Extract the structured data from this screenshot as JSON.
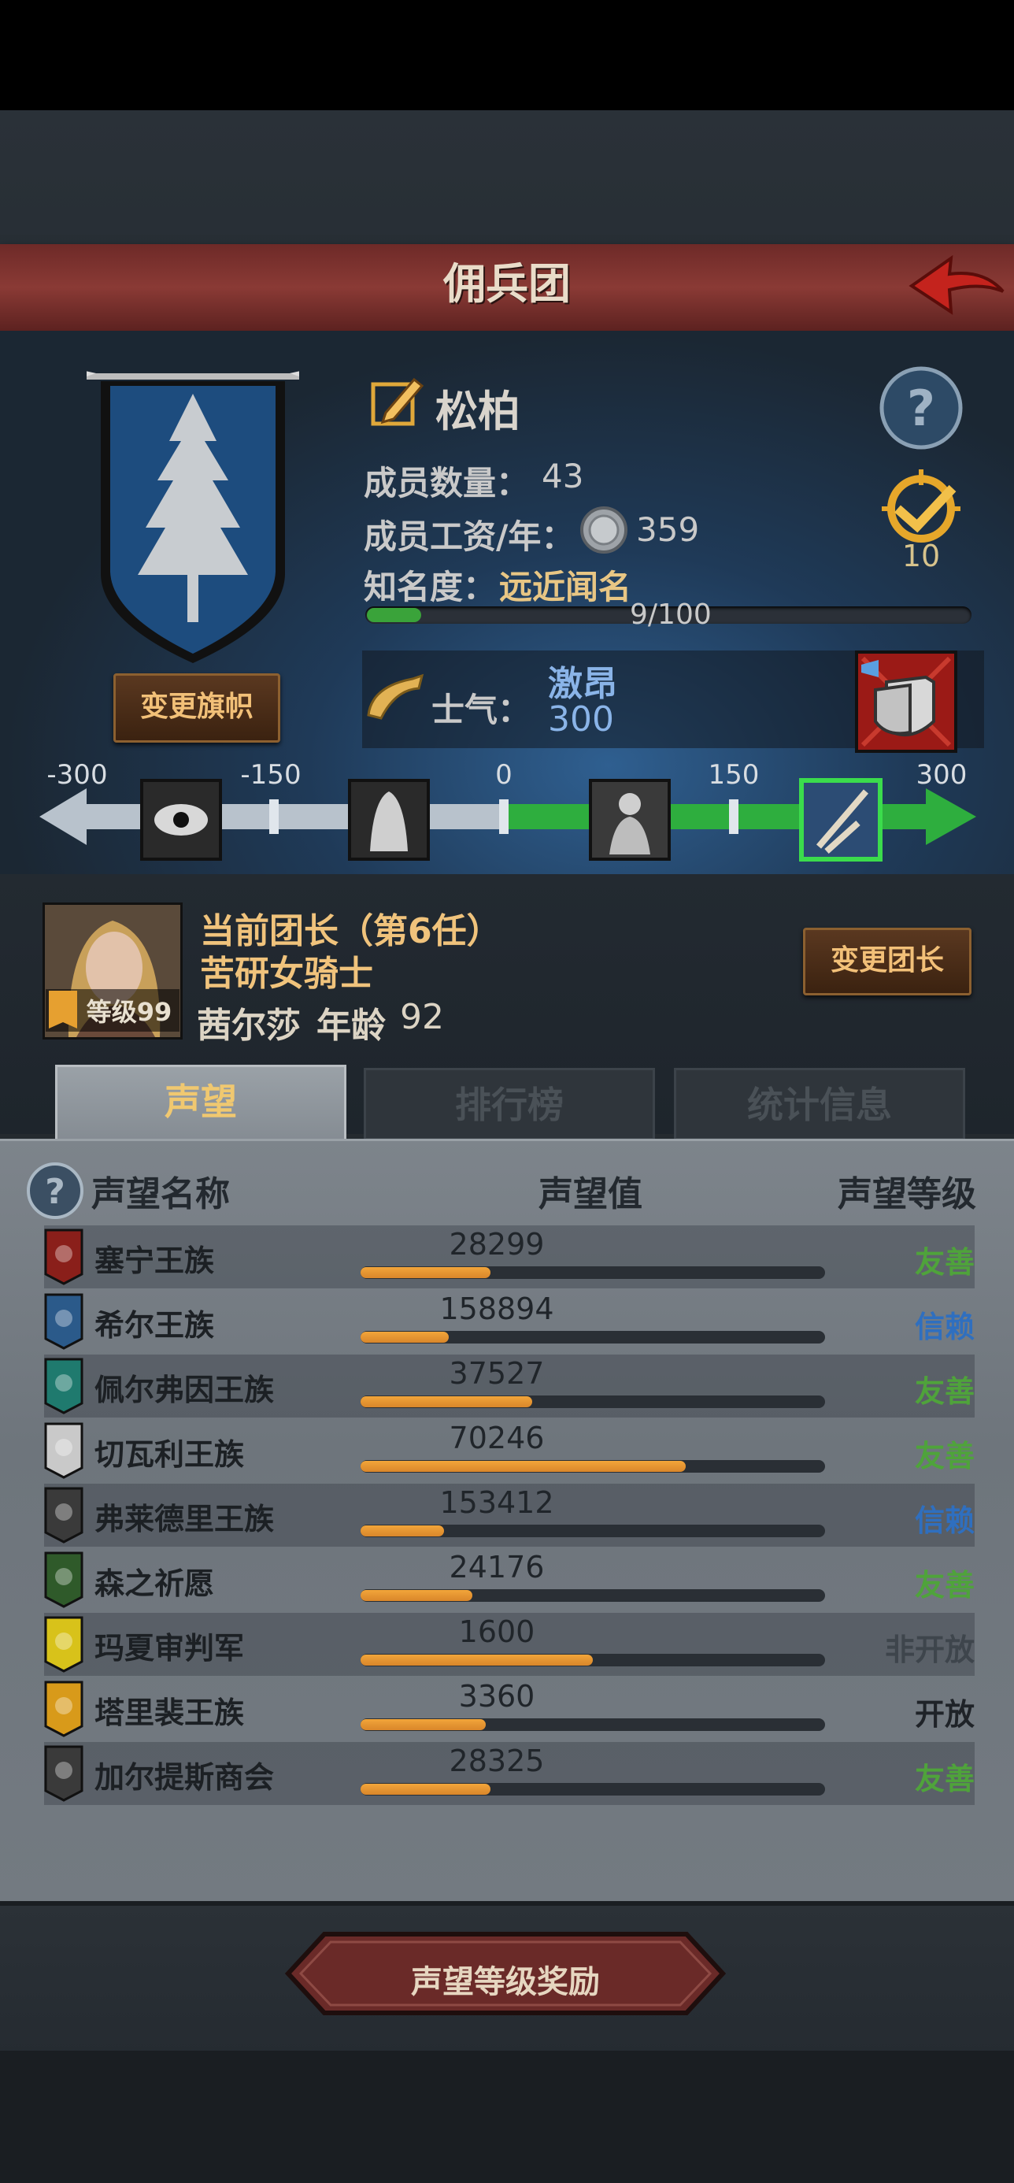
{
  "header": {
    "title": "佣兵团"
  },
  "clan": {
    "name": "松柏",
    "members_label": "成员数量：",
    "members_value": "43",
    "salary_label": "成员工资/年：",
    "salary_value": "359",
    "fame_label": "知名度：",
    "fame_value": "远近闻名",
    "fame_progress_text": "9/100",
    "fame_progress_fraction": 0.09,
    "medal_count": "10",
    "change_flag_label": "变更旗帜"
  },
  "morale": {
    "label": "士气：",
    "name": "激昂",
    "value": "300",
    "scale_ticks": [
      "-300",
      "-150",
      "0",
      "150",
      "300"
    ],
    "current_value": 300
  },
  "leader": {
    "title": "当前团长（第6任）",
    "class": "苦研女骑士",
    "name": "茜尔莎",
    "age_label": "年龄",
    "age_value": "92",
    "level": "等级99",
    "change_label": "变更团长"
  },
  "tabs": [
    {
      "label": "声望",
      "active": true
    },
    {
      "label": "排行榜",
      "active": false
    },
    {
      "label": "统计信息",
      "active": false
    }
  ],
  "reputation": {
    "headers": {
      "name": "声望名称",
      "value": "声望值",
      "level": "声望等级"
    },
    "rows": [
      {
        "name": "塞宁王族",
        "value": "28299",
        "fill": 0.28,
        "level": "友善",
        "level_color": "#4fa33b",
        "icon_color": "#8a1f1a"
      },
      {
        "name": "希尔王族",
        "value": "158894",
        "fill": 0.19,
        "level": "信赖",
        "level_color": "#2f6fbf",
        "icon_color": "#2b5a8a"
      },
      {
        "name": "佩尔弗因王族",
        "value": "37527",
        "fill": 0.37,
        "level": "友善",
        "level_color": "#4fa33b",
        "icon_color": "#1f7a6e"
      },
      {
        "name": "切瓦利王族",
        "value": "70246",
        "fill": 0.7,
        "level": "友善",
        "level_color": "#4fa33b",
        "icon_color": "#c9c9c9"
      },
      {
        "name": "弗莱德里王族",
        "value": "153412",
        "fill": 0.18,
        "level": "信赖",
        "level_color": "#2f6fbf",
        "icon_color": "#3a3a3a"
      },
      {
        "name": "森之祈愿",
        "value": "24176",
        "fill": 0.24,
        "level": "友善",
        "level_color": "#4fa33b",
        "icon_color": "#2f5a2a"
      },
      {
        "name": "玛夏审判军",
        "value": "1600",
        "fill": 0.5,
        "level": "非开放",
        "level_color": "#3e454c",
        "icon_color": "#d8c21a"
      },
      {
        "name": "塔里裴王族",
        "value": "3360",
        "fill": 0.27,
        "level": "开放",
        "level_color": "#1f2328",
        "icon_color": "#d89a1a"
      },
      {
        "name": "加尔提斯商会",
        "value": "28325",
        "fill": 0.28,
        "level": "友善",
        "level_color": "#4fa33b",
        "icon_color": "#3a3a3a"
      }
    ]
  },
  "footer": {
    "reward_label": "声望等级奖励"
  },
  "colors": {
    "header": "#7a302c",
    "accent": "#f0c37c",
    "morale_blue": "#8ab4e8",
    "green": "#3aa33a",
    "orange": "#e8962e"
  }
}
